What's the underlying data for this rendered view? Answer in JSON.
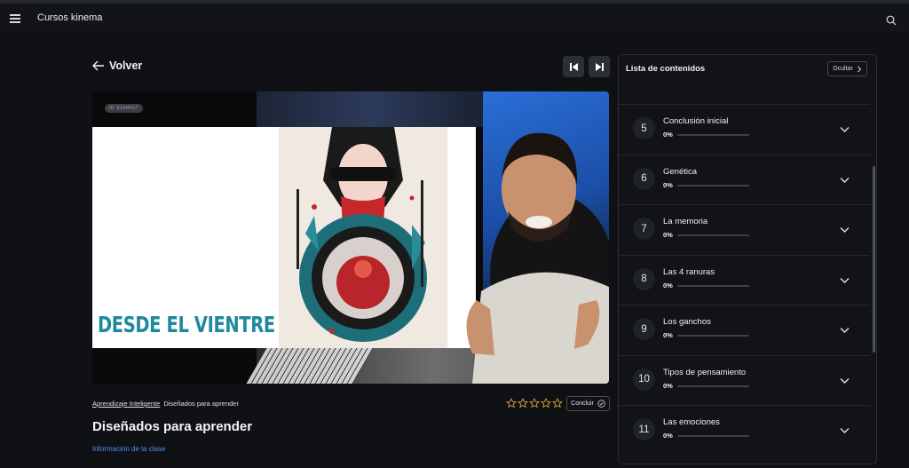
{
  "header": {
    "title": "Cursos kinema",
    "menu_icon": "hamburger-icon",
    "search_icon": "search-icon"
  },
  "nav": {
    "back_label": "Volver",
    "prev_icon": "skip-previous-icon",
    "next_icon": "skip-next-icon"
  },
  "video": {
    "id_badge": "ID: 81344117",
    "slide_text": "DESDE EL VIENTRE"
  },
  "lesson": {
    "breadcrumb_course": "Aprendizaje Inteligente",
    "breadcrumb_lesson": "Diseñados para aprender",
    "title": "Diseñados para aprender",
    "info_link": "Información de la clase",
    "rating": {
      "value": 0,
      "max": 5
    },
    "complete_label": "Concluir"
  },
  "panel": {
    "title": "Lista de contenidos",
    "hide_label": "Ocultar",
    "items": [
      {
        "number": "5",
        "title": "Conclusión inicial",
        "progress": "0%"
      },
      {
        "number": "6",
        "title": "Genética",
        "progress": "0%"
      },
      {
        "number": "7",
        "title": "La memoria",
        "progress": "0%"
      },
      {
        "number": "8",
        "title": "Las 4 ranuras",
        "progress": "0%"
      },
      {
        "number": "9",
        "title": "Los ganchos",
        "progress": "0%"
      },
      {
        "number": "10",
        "title": "Tipos de pensamiento",
        "progress": "0%"
      },
      {
        "number": "11",
        "title": "Las emociones",
        "progress": "0%"
      }
    ]
  },
  "colors": {
    "accent": "#4f8ff7",
    "background": "#0f1114",
    "panel": "#111316",
    "star": "#d9a23a"
  }
}
